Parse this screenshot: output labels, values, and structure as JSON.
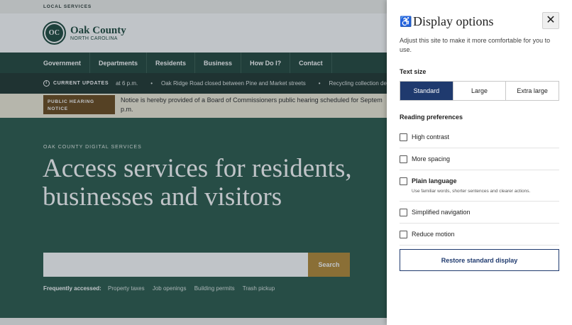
{
  "site": {
    "topbar_label": "LOCAL SERVICES",
    "brand": {
      "seal_text": "OC",
      "name": "Oak County",
      "state": "NORTH CAROLINA"
    },
    "nav": [
      "Government",
      "Departments",
      "Residents",
      "Business",
      "How Do I?",
      "Contact"
    ],
    "updates": {
      "label": "CURRENT UPDATES",
      "items": [
        "at 6 p.m.",
        "Oak Ridge Road closed between Pine and Market streets",
        "Recycling collection del"
      ]
    },
    "notice": {
      "badge": "PUBLIC HEARING NOTICE",
      "text": "Notice is hereby provided of a Board of Commissioners public hearing scheduled for Septem p.m."
    },
    "hero": {
      "eyebrow": "OAK COUNTY DIGITAL SERVICES",
      "headline": "Access services for residents, businesses and visitors",
      "search_button": "Search",
      "frequent_label": "Frequently accessed:",
      "frequent_links": [
        "Property taxes",
        "Job openings",
        "Building permits",
        "Trash pickup"
      ]
    }
  },
  "panel": {
    "icon": "accessibility-icon",
    "title": "Display options",
    "close_icon": "close-icon",
    "description": "Adjust this site to make it more comfortable for you to use.",
    "text_size": {
      "label": "Text size",
      "options": [
        "Standard",
        "Large",
        "Extra large"
      ],
      "selected": "Standard"
    },
    "reading": {
      "label": "Reading preferences",
      "options": [
        {
          "label": "High contrast",
          "checked": false
        },
        {
          "label": "More spacing",
          "checked": false
        },
        {
          "label": "Plain language",
          "help": "Use familiar words, shorter sentences and clearer actions.",
          "checked": false
        },
        {
          "label": "Simplified navigation",
          "checked": false
        },
        {
          "label": "Reduce motion",
          "checked": false
        }
      ]
    },
    "restore_label": "Restore standard display"
  },
  "colors": {
    "brand_green": "#23473c",
    "hero_green": "#2c5a4b",
    "accent_gold": "#b58a35",
    "panel_blue": "#1f3a6e"
  }
}
